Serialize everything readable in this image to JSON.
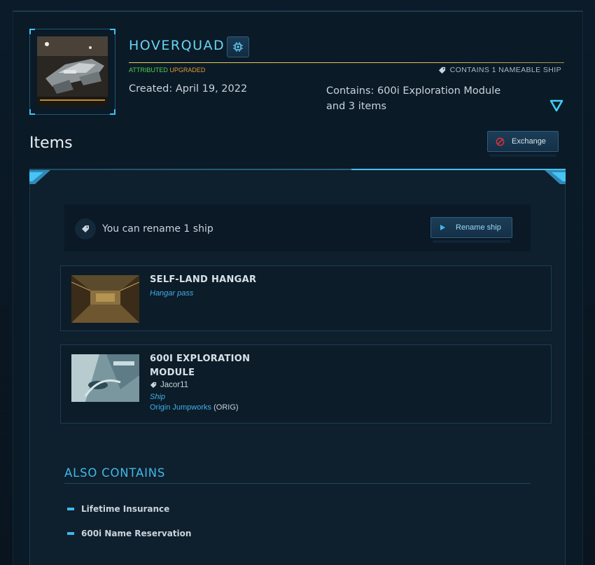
{
  "package": {
    "title": "HOVERQUAD",
    "tag_attributed": "ATTRIBUTED",
    "tag_upgraded": "UPGRADED",
    "nameable_label": "CONTAINS 1 NAMEABLE SHIP",
    "created": "Created: April 19, 2022",
    "contains_line1": "Contains: 600i Exploration Module",
    "contains_line2": "and 3 items"
  },
  "items_section": {
    "heading": "Items",
    "exchange_label": "Exchange"
  },
  "rename": {
    "text_prefix": "You can rename ",
    "count": "1",
    "text_suffix": " ship",
    "button_label": "Rename ship"
  },
  "items": [
    {
      "name": "SELF-LAND HANGAR",
      "type": "Hangar pass"
    },
    {
      "name_line1": "600I EXPLORATION",
      "name_line2": "MODULE",
      "owner": "Jacor11",
      "type": "Ship",
      "manufacturer": "Origin Jumpworks",
      "manufacturer_code": "(ORIG)"
    }
  ],
  "also_contains": {
    "heading": "ALSO CONTAINS",
    "entries": [
      "Lifetime Insurance",
      "600i Name Reservation"
    ]
  },
  "colors": {
    "accent": "#40b8ea",
    "title": "#6ad3f2",
    "attributed": "#55d24a",
    "upgraded": "#e49b2f",
    "rule": "#e6d05c",
    "exchange_icon": "#e0303a"
  },
  "icons": [
    "chip-icon",
    "tag-icon",
    "expand-triangle-icon",
    "no-entry-icon",
    "play-icon",
    "bullet-icon"
  ]
}
